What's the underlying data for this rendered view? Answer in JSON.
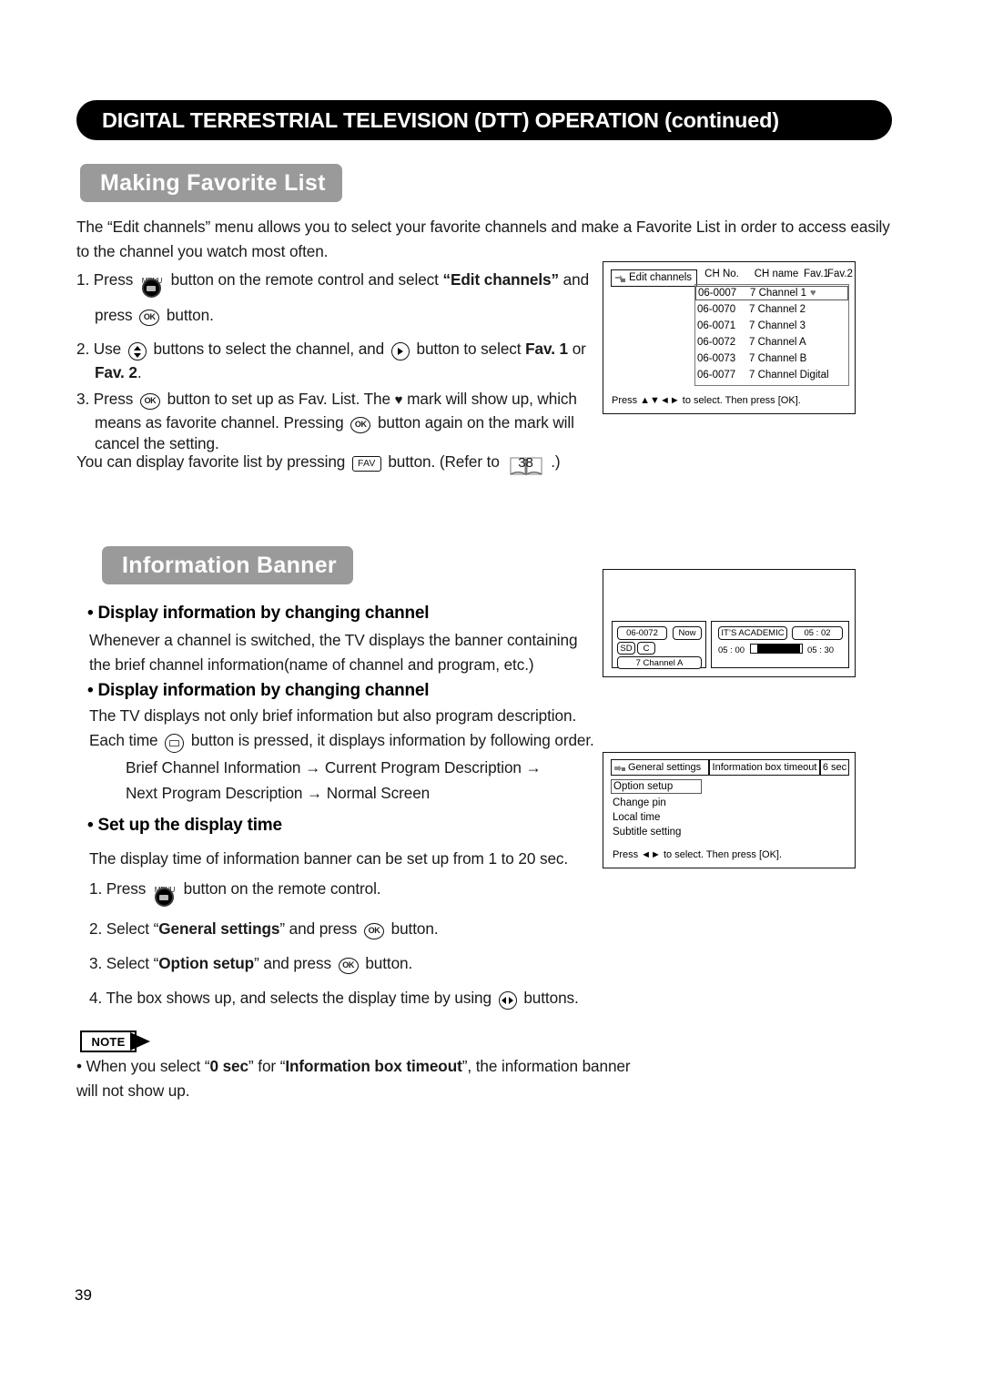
{
  "page": {
    "number": "39",
    "title": "DIGITAL TERRESTRIAL TELEVISION (DTT) OPERATION (continued)"
  },
  "sections": {
    "favorite": {
      "heading": "Making Favorite List",
      "intro": "The “Edit channels” menu allows you to select your favorite channels and make a Favorite List in order to access easily to the channel you watch most often.",
      "step1_a": "1. Press",
      "step1_b": "button on the remote control and select",
      "step1_c": "“Edit channels”",
      "step1_d": "and",
      "step1_e": "press",
      "step1_f": "button.",
      "step2_a": "2. Use",
      "step2_b": "buttons to select the channel, and",
      "step2_c": "button to select",
      "step2_d": "Fav. 1",
      "step2_e": "or",
      "step2_f": "Fav. 2",
      "step2_g": ".",
      "step3_a": "3. Press",
      "step3_b": "button to set up as Fav. List. The",
      "step3_heart": "♥",
      "step3_c": "mark will show up, which",
      "step3_d": "means as favorite channel. Pressing",
      "step3_e": "button again on the mark will",
      "step3_f": "cancel the setting.",
      "step4_a": "You can display favorite list by pressing",
      "step4_fav": "FAV",
      "step4_b": "button. (Refer to",
      "step4_page": "38",
      "step4_c": ".)"
    },
    "banner": {
      "heading": "Information Banner",
      "sub1": "• Display information by changing channel",
      "sub1_body": "Whenever a channel is switched, the TV displays the banner containing the brief channel information(name of channel and program, etc.)",
      "sub2": "• Display information by changing channel",
      "sub2_body": "The TV displays not only brief information but also program description.",
      "sub2_each_a": "Each time",
      "sub2_each_b": "button is pressed, it displays information by following order.",
      "order_line1": "Brief Channel Information → Current Program Description →",
      "order_line2": "Next Program Description → Normal Screen",
      "sub3": "• Set up the display time",
      "sub3_body": "The display time of information banner can be set up from 1 to 20 sec.",
      "s1_a": "1. Press",
      "s1_b": "button on the remote control.",
      "s2_a": "2. Select “",
      "s2_b": "General settings",
      "s2_c": "” and press",
      "s2_d": "button.",
      "s3_a": "3. Select “",
      "s3_b": "Option setup",
      "s3_c": "” and press",
      "s3_d": "button.",
      "s4_a": "4. The box shows up, and selects the display time by using",
      "s4_b": "buttons."
    },
    "note": {
      "label": "NOTE",
      "text_a": "• When you select “",
      "text_b": "0 sec",
      "text_c": "” for “",
      "text_d": "Information box timeout",
      "text_e": "”, the information",
      "text_f": "banner will not show up."
    }
  },
  "diagrams": {
    "edit_channels": {
      "tab_label": "Edit channels",
      "columns": [
        "CH No.",
        "CH name",
        "Fav.1",
        "Fav.2"
      ],
      "rows": [
        {
          "ch_no": "06-0007",
          "ch_name": "7 Channel 1",
          "fav_mark": "♥",
          "selected": true
        },
        {
          "ch_no": "06-0070",
          "ch_name": "7 Channel 2",
          "fav_mark": "",
          "selected": false
        },
        {
          "ch_no": "06-0071",
          "ch_name": "7 Channel 3",
          "fav_mark": "",
          "selected": false
        },
        {
          "ch_no": "06-0072",
          "ch_name": "7 Channel A",
          "fav_mark": "",
          "selected": false
        },
        {
          "ch_no": "06-0073",
          "ch_name": "7 Channel B",
          "fav_mark": "",
          "selected": false
        },
        {
          "ch_no": "06-0077",
          "ch_name": "7 Channel Digital",
          "fav_mark": "",
          "selected": false
        }
      ],
      "footer": "Press ▲▼◄► to select. Then press [OK]."
    },
    "info_banner": {
      "channel_no": "06-0072",
      "now_label": "Now",
      "badge_sd": "SD",
      "badge_c": "C",
      "channel_name": "7 Channel A",
      "program_title": "IT’S ACADEMIC",
      "clock": "05 : 02",
      "start_time": "05 : 00",
      "end_time": "05 : 30",
      "progress_percent": 12
    },
    "general_settings": {
      "tab_label": "General settings",
      "option_label": "Information box timeout",
      "option_value": "6 sec",
      "items": [
        {
          "label": "Option setup",
          "selected": true
        },
        {
          "label": "Change pin",
          "selected": false
        },
        {
          "label": "Local time",
          "selected": false
        },
        {
          "label": "Subtitle setting",
          "selected": false
        }
      ],
      "footer": "Press ◄► to select. Then press [OK]."
    }
  },
  "colors": {
    "title_bar_bg": "#000000",
    "section_heading_bg": "#9a9a9a",
    "text": "#1a1a1a"
  }
}
